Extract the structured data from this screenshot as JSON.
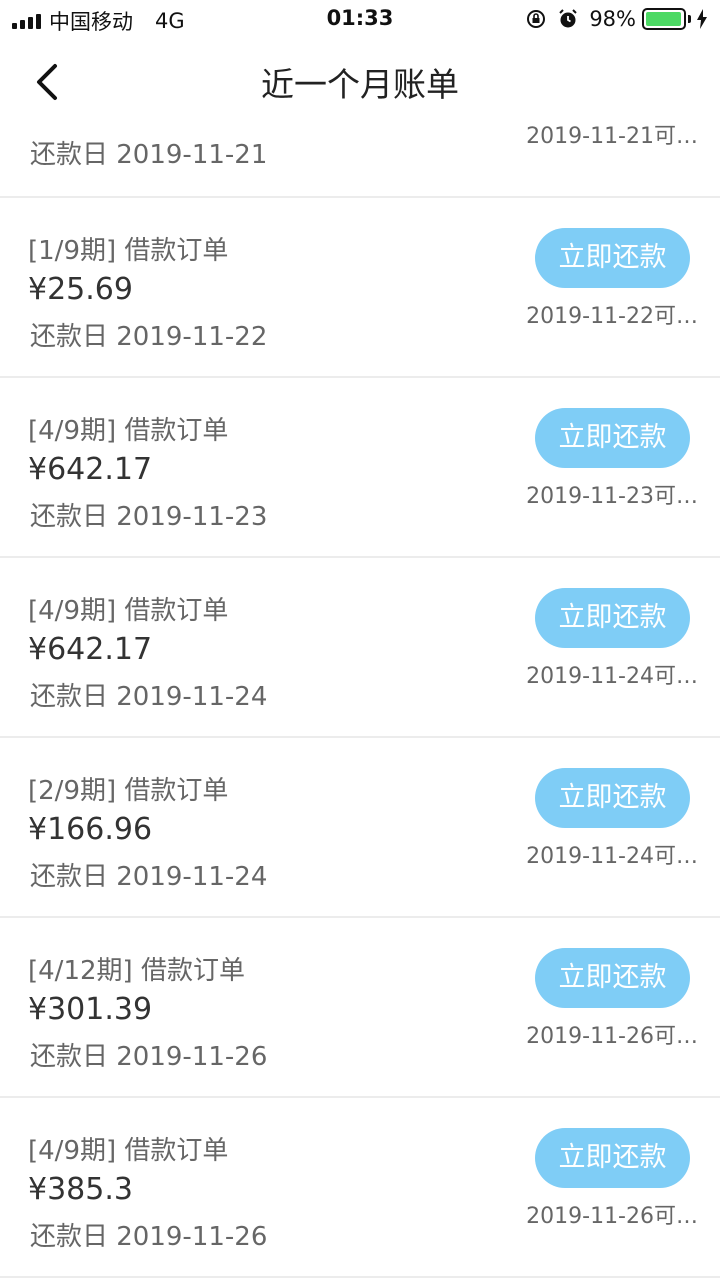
{
  "status_bar": {
    "carrier": "中国移动",
    "network": "4G",
    "time": "01:33",
    "battery": "98%",
    "battery_level": 0.98,
    "battery_color": "#4cd964"
  },
  "nav": {
    "title": "近一个月账单",
    "back_icon": "chevron-left-icon"
  },
  "partial_row": {
    "due": "还款日 2019-11-21",
    "note": "2019-11-21可…"
  },
  "bills": [
    {
      "title": "[1/9期] 借款订单",
      "amount": "¥25.69",
      "due": "还款日 2019-11-22",
      "button": "立即还款",
      "note": "2019-11-22可…"
    },
    {
      "title": "[4/9期] 借款订单",
      "amount": "¥642.17",
      "due": "还款日 2019-11-23",
      "button": "立即还款",
      "note": "2019-11-23可…"
    },
    {
      "title": "[4/9期] 借款订单",
      "amount": "¥642.17",
      "due": "还款日 2019-11-24",
      "button": "立即还款",
      "note": "2019-11-24可…"
    },
    {
      "title": "[2/9期] 借款订单",
      "amount": "¥166.96",
      "due": "还款日 2019-11-24",
      "button": "立即还款",
      "note": "2019-11-24可…"
    },
    {
      "title": "[4/12期] 借款订单",
      "amount": "¥301.39",
      "due": "还款日 2019-11-26",
      "button": "立即还款",
      "note": "2019-11-26可…"
    },
    {
      "title": "[4/9期] 借款订单",
      "amount": "¥385.3",
      "due": "还款日 2019-11-26",
      "button": "立即还款",
      "note": "2019-11-26可…"
    }
  ],
  "colors": {
    "button_bg": "#7fcdf6",
    "divider": "#ececec"
  }
}
